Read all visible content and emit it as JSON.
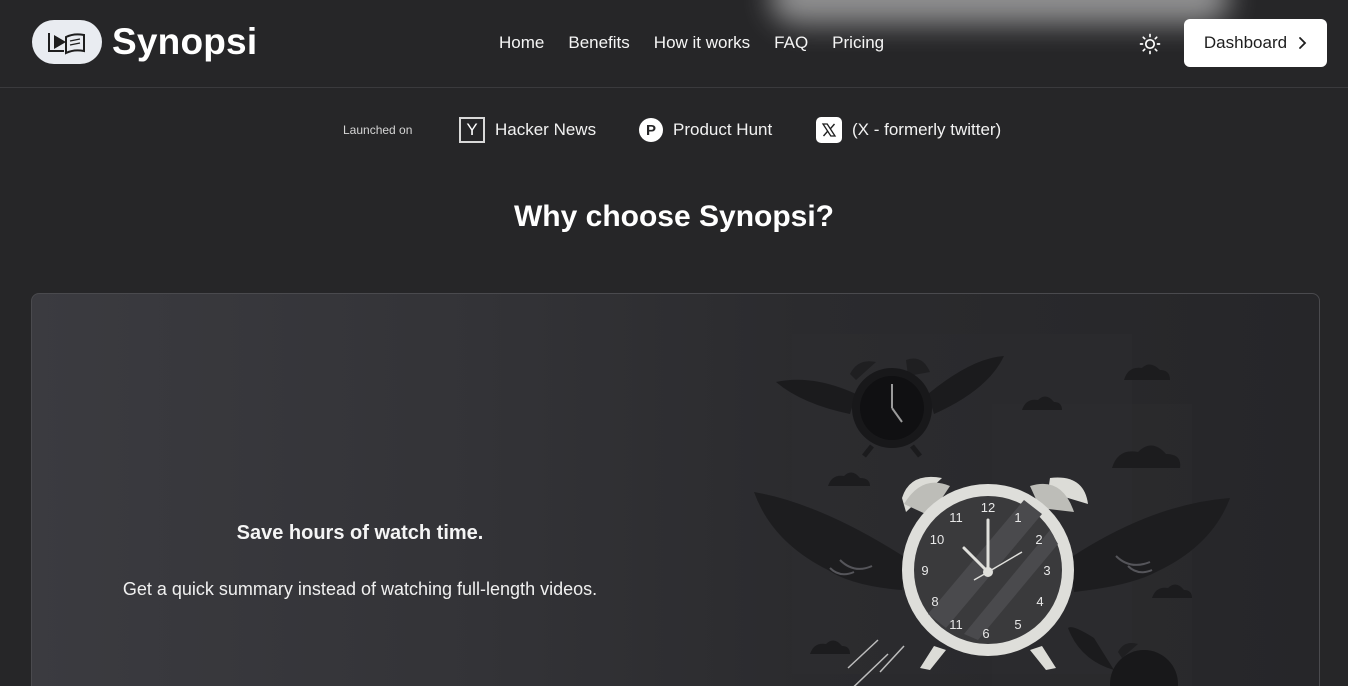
{
  "brand": {
    "name": "Synopsi",
    "logo_icon": "play-book-icon"
  },
  "nav": {
    "items": [
      "Home",
      "Benefits",
      "How it works",
      "FAQ",
      "Pricing"
    ]
  },
  "header": {
    "theme_icon": "sun-icon",
    "dashboard_label": "Dashboard",
    "dashboard_icon": "chevron-right-icon"
  },
  "launched": {
    "label": "Launched on",
    "items": [
      {
        "icon": "y-combinator-icon",
        "glyph": "Y",
        "label": "Hacker News"
      },
      {
        "icon": "product-hunt-icon",
        "glyph": "P",
        "label": "Product Hunt"
      },
      {
        "icon": "x-logo-icon",
        "label": "(X - formerly twitter)"
      }
    ]
  },
  "section": {
    "title": "Why choose Synopsi?"
  },
  "benefit": {
    "heading": "Save hours of watch time.",
    "text": "Get a quick summary instead of watching full-length videos.",
    "illustration": "flying-alarm-clock-illustration",
    "clock_numbers": [
      "12",
      "1",
      "2",
      "3",
      "4",
      "5",
      "6",
      "11",
      "8",
      "9",
      "10",
      "11"
    ]
  },
  "colors": {
    "background": "#262628",
    "button_bg": "#ffffff",
    "text": "#f2f2f2"
  }
}
